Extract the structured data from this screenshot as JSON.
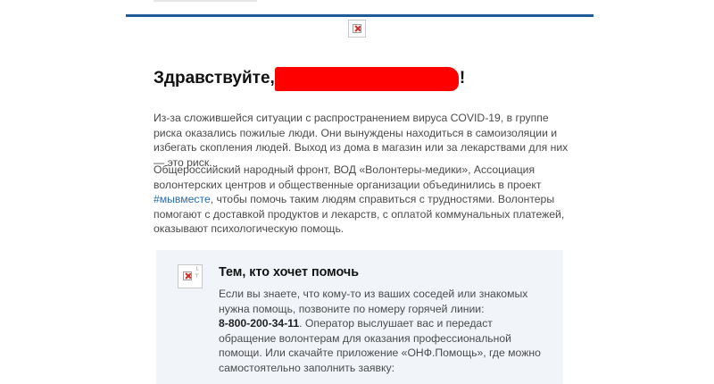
{
  "greeting": {
    "prefix": "Здравствуйте,",
    "suffix": "!"
  },
  "paragraphs": {
    "p1": "Из-за сложившейся ситуации с распространением вируса COVID-19, в группе риска оказались пожилые люди. Они вынуждены находиться в самоизоляции и избегать скопления людей. Выход из дома в магазин или за лекарствами для них — это риск.",
    "p2_before": "Общероссийский народный фронт, ВОД «Волонтеры-медики», Ассоциация волонтерских центров и общественные организации объединились в проект",
    "p2_hashtag": "#мывместе",
    "p2_after": ", чтобы помочь таким людям справиться с трудностями. Волонтеры помогают с доставкой продуктов и лекарств, с оплатой коммунальных платежей, оказывают психологическую помощь."
  },
  "callout": {
    "icon_text": "└ ⊤",
    "title": "Тем, кто хочет помочь",
    "body_before": "Если вы знаете, что кому-то из ваших соседей или знакомых нужна помощь, позвоните по номеру горячей линии:",
    "phone": "8-800-200-34-11",
    "body_after": ". Оператор выслушает вас и передаст обращение волонтерам для оказания профессиональной помощи. Или скачайте приложение «ОНФ.Помощь», где можно самостоятельно заполнить заявку:"
  },
  "colors": {
    "accent_rule": "#1d5c98",
    "hashtag_link": "#2b6cb0",
    "redaction": "#ff0000",
    "callout_background": "#f1f5fa"
  },
  "icons": {
    "header_logo": "broken-image-icon",
    "callout_image": "broken-image-icon"
  }
}
